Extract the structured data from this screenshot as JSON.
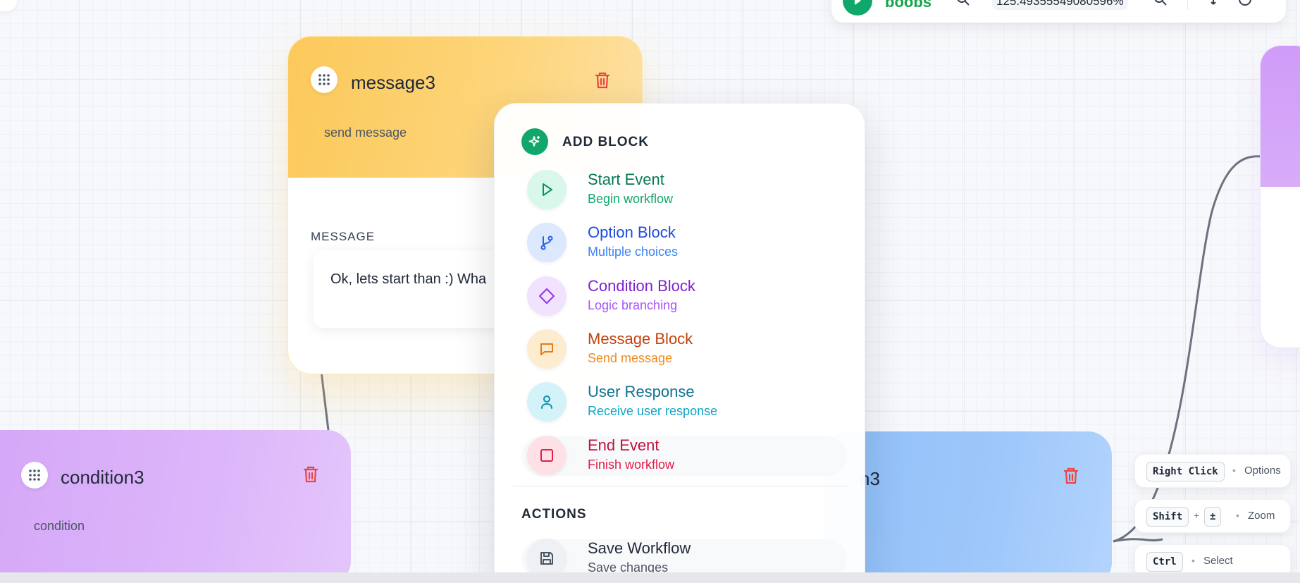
{
  "toolbar": {
    "workflow_name": "boobs",
    "zoom_value": "125.49355549080596%"
  },
  "nodes": {
    "message": {
      "title": "message3",
      "subtitle": "send message",
      "section_label": "MESSAGE",
      "text": "Ok, lets start than :) Wha"
    },
    "condition": {
      "title": "condition3",
      "subtitle": "condition"
    },
    "blue": {
      "title_fragment": "n3"
    }
  },
  "menu": {
    "title": "ADD BLOCK",
    "items": [
      {
        "label": "Start Event",
        "desc": "Begin workflow",
        "icon": "play-icon",
        "label_color": "#047857",
        "desc_color": "#10a86a",
        "bg": "#d9f7ea",
        "stroke": "#059669"
      },
      {
        "label": "Option Block",
        "desc": "Multiple choices",
        "icon": "git-branch-icon",
        "label_color": "#1d4ed8",
        "desc_color": "#3b82f6",
        "bg": "#dbe8fd",
        "stroke": "#2563eb"
      },
      {
        "label": "Condition Block",
        "desc": "Logic branching",
        "icon": "diamond-icon",
        "label_color": "#7e22ce",
        "desc_color": "#a855f7",
        "bg": "#f1e2fd",
        "stroke": "#9333ea"
      },
      {
        "label": "Message Block",
        "desc": "Send message",
        "icon": "message-square-icon",
        "label_color": "#c2410c",
        "desc_color": "#f08a1c",
        "bg": "#fdeccf",
        "stroke": "#ea7a12"
      },
      {
        "label": "User Response",
        "desc": "Receive user response",
        "icon": "user-icon",
        "label_color": "#0e7490",
        "desc_color": "#0ea5c6",
        "bg": "#d4f3f8",
        "stroke": "#0891b2"
      },
      {
        "label": "End Event",
        "desc": "Finish workflow",
        "icon": "square-icon",
        "label_color": "#be123c",
        "desc_color": "#e11d48",
        "bg": "#fde1e6",
        "stroke": "#e11d48"
      }
    ],
    "actions_title": "ACTIONS",
    "actions": [
      {
        "label": "Save Workflow",
        "desc": "Save changes",
        "icon": "save-icon",
        "label_color": "#1f2937",
        "desc_color": "#4b5563",
        "bg": "#eef0f3",
        "stroke": "#4b5563"
      }
    ]
  },
  "hints": [
    {
      "keys": [
        "Right Click"
      ],
      "label": "Options"
    },
    {
      "keys": [
        "Shift",
        "±"
      ],
      "label": "Zoom"
    },
    {
      "keys": [
        "Ctrl"
      ],
      "label": "Select"
    }
  ],
  "colors": {
    "accent_green": "#10a86a",
    "delete_red": "#ef4444",
    "message_header": "#fcc95a",
    "condition_header": "#d6a8f8",
    "blue_header": "#8fbff8"
  }
}
